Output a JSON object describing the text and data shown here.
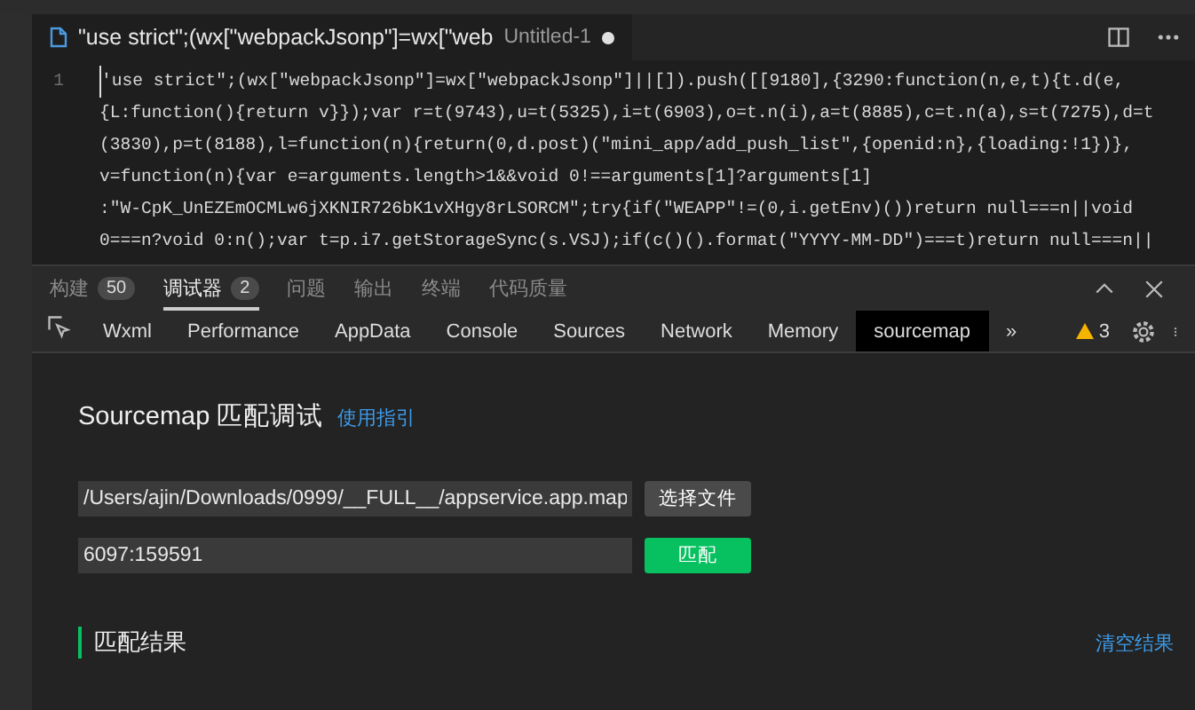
{
  "editor": {
    "tab": {
      "title": "\"use strict\";(wx[\"webpackJsonp\"]=wx[\"web",
      "subtitle": "Untitled-1",
      "unsaved": true
    },
    "line_number": "1",
    "code_lines": [
      "'use strict\";(wx[\"webpackJsonp\"]=wx[\"webpackJsonp\"]||[]).push([[9180],{3290:function(n,e,t){t.d(e,",
      "{L:function(){return v}});var r=t(9743),u=t(5325),i=t(6903),o=t.n(i),a=t(8885),c=t.n(a),s=t(7275),d=t",
      "(3830),p=t(8188),l=function(n){return(0,d.post)(\"mini_app/add_push_list\",{openid:n},{loading:!1})},",
      "v=function(n){var e=arguments.length>1&&void 0!==arguments[1]?arguments[1]",
      ":\"W-CpK_UnEZEmOCMLw6jXKNIR726bK1vXHgy8rLSORCM\";try{if(\"WEAPP\"!=(0,i.getEnv)())return null===n||void",
      "0===n?void 0:n();var t=p.i7.getStorageSync(s.VSJ);if(c()().format(\"YYYY-MM-DD\")===t)return null===n||"
    ]
  },
  "panel_tabs": [
    {
      "label": "构建",
      "count": "50",
      "selected": false
    },
    {
      "label": "调试器",
      "count": "2",
      "selected": true
    },
    {
      "label": "问题",
      "selected": false
    },
    {
      "label": "输出",
      "selected": false
    },
    {
      "label": "终端",
      "selected": false
    },
    {
      "label": "代码质量",
      "selected": false
    }
  ],
  "devtools_tabs": [
    {
      "label": "Wxml",
      "selected": false
    },
    {
      "label": "Performance",
      "selected": false
    },
    {
      "label": "AppData",
      "selected": false
    },
    {
      "label": "Console",
      "selected": false
    },
    {
      "label": "Sources",
      "selected": false
    },
    {
      "label": "Network",
      "selected": false
    },
    {
      "label": "Memory",
      "selected": false
    },
    {
      "label": "sourcemap",
      "selected": true
    }
  ],
  "overflow": "»",
  "warnings": "3",
  "sourcemap": {
    "title": "Sourcemap 匹配调试",
    "guide_link": "使用指引",
    "file_path": "/Users/ajin/Downloads/0999/__FULL__/appservice.app.map",
    "choose_button": "选择文件",
    "position": "6097:159591",
    "match_button": "匹配",
    "result_title": "匹配结果",
    "clear_link": "清空结果"
  }
}
